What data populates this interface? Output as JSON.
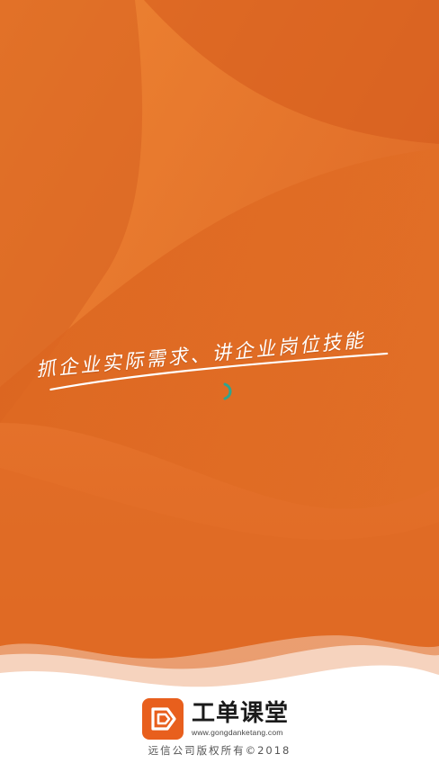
{
  "splash": {
    "slogan": "抓企业实际需求、讲企业岗位技能",
    "loading_icon": "spinner-icon",
    "brand": {
      "logo_icon": "gongdan-logo-icon",
      "name": "工单课堂",
      "url": "www.gongdanketang.com"
    },
    "copyright": "远信公司版权所有©2018"
  },
  "colors": {
    "background": "#e06a22",
    "wave_dark": "#d85d1e",
    "wave_light": "#e8772a",
    "brand_orange": "#e85f1d",
    "spinner": "#2ea58f",
    "footer_bg": "#ffffff",
    "text_dark": "#1a1a1a"
  }
}
